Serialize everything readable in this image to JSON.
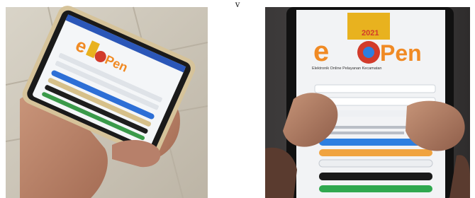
{
  "caption": "y",
  "photos": [
    {
      "subject": "Hand holding smartphone showing the app login screen",
      "app": {
        "brand_letter": "e",
        "brand_word": "Pen",
        "colors": {
          "orange": "#f08a24",
          "gold": "#e8b21f",
          "red": "#d23b2b",
          "blue": "#2d6fd6",
          "dark": "#1e1e1e",
          "green": "#3a9a4a"
        }
      }
    },
    {
      "subject": "Close-up of phone screen displaying e-Pen login page",
      "app": {
        "brand_letter": "e",
        "brand_word": "Pen",
        "year": "2021",
        "tagline": "Elektronik Online Pelayanan Kecamatan",
        "colors": {
          "orange": "#f08a24",
          "gold": "#e8b21f",
          "red": "#d23b2b",
          "blue": "#2d7fe0",
          "dark": "#1a1a1a",
          "green": "#2fa84f"
        }
      }
    }
  ]
}
